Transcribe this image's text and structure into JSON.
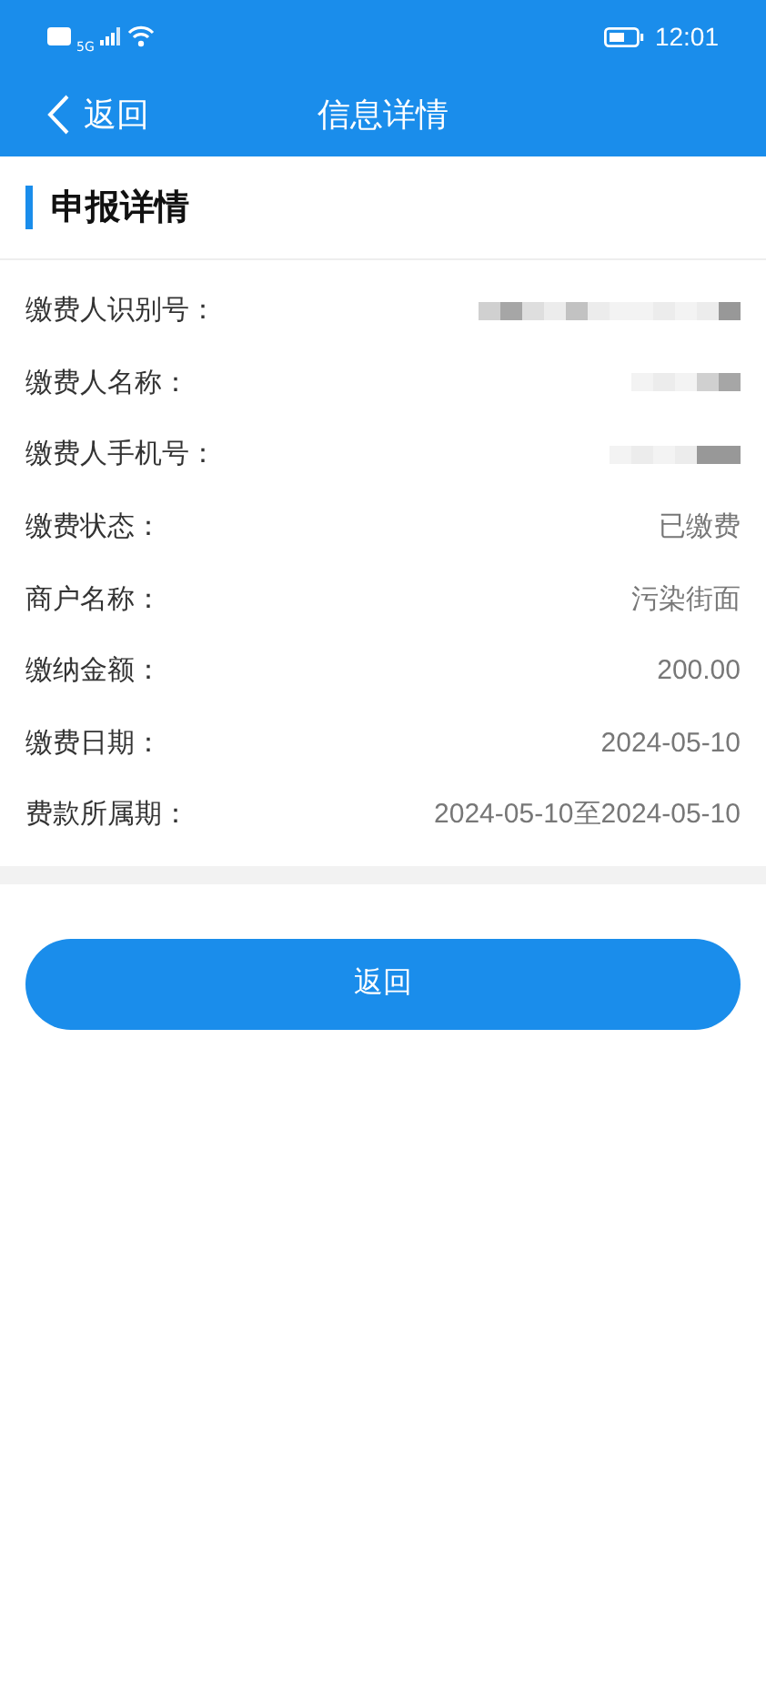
{
  "status_bar": {
    "time": "12:01",
    "network": "5G"
  },
  "nav": {
    "back": "返回",
    "title": "信息详情"
  },
  "section": {
    "title": "申报详情"
  },
  "rows": [
    {
      "label": "缴费人识别号：",
      "kind": "masked"
    },
    {
      "label": "缴费人名称：",
      "kind": "masked"
    },
    {
      "label": "缴费人手机号：",
      "kind": "masked"
    },
    {
      "label": "缴费状态：",
      "kind": "text",
      "value": "已缴费"
    },
    {
      "label": "商户名称：",
      "kind": "text",
      "value": "污染街面"
    },
    {
      "label": "缴纳金额：",
      "kind": "text",
      "value": "200.00"
    },
    {
      "label": "缴费日期：",
      "kind": "text",
      "value": "2024-05-10"
    },
    {
      "label": "费款所属期：",
      "kind": "text",
      "value": "2024-05-10至2024-05-10"
    }
  ],
  "button": "返回"
}
